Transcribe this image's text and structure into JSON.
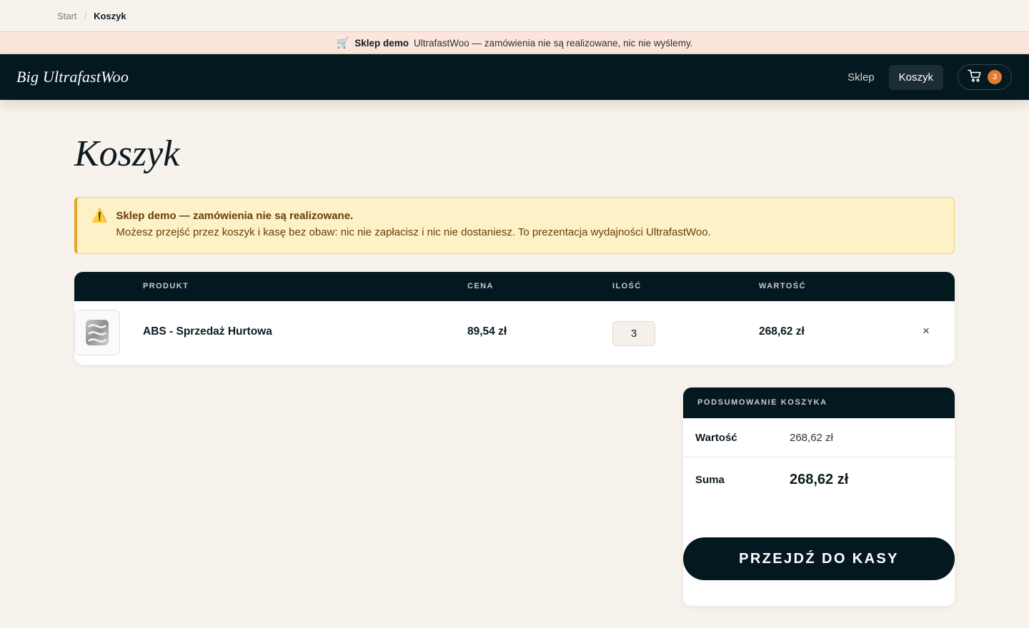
{
  "breadcrumb": {
    "start": "Start",
    "separator": "/",
    "current": "Koszyk"
  },
  "demo_strip": {
    "icon": "shopping-cart-emoji",
    "strong": "Sklep demo",
    "text": "UltrafastWoo — zamówienia nie są realizowane, nic nie wyślemy."
  },
  "header": {
    "logo": "Big UltrafastWoo",
    "nav": {
      "shop": "Sklep",
      "cart": "Koszyk"
    },
    "cart_count": "3"
  },
  "page": {
    "title": "Koszyk"
  },
  "notice": {
    "icon": "warning-icon",
    "title": "Sklep demo — zamówienia nie są realizowane.",
    "text": "Możesz przejść przez koszyk i kasę bez obaw: nic nie zapłacisz i nic nie dostaniesz. To prezentacja wydajności UltrafastWoo."
  },
  "table": {
    "headers": {
      "product": "PRODUKT",
      "price": "CENA",
      "qty": "ILOŚĆ",
      "total": "WARTOŚĆ"
    },
    "rows": [
      {
        "name": "ABS - Sprzedaż Hurtowa",
        "price": "89,54 zł",
        "qty": "3",
        "total": "268,62 zł",
        "remove": "×"
      }
    ]
  },
  "summary": {
    "title": "PODSUMOWANIE KOSZYKA",
    "subtotal_label": "Wartość",
    "subtotal_value": "268,62 zł",
    "total_label": "Suma",
    "total_value": "268,62 zł",
    "checkout_label": "PRZEJDŹ DO KASY"
  },
  "colors": {
    "dark": "#041820",
    "background": "#f7f3ec",
    "badge": "#e07a2e",
    "notice_bg": "#fdf1c7",
    "notice_border": "#e3a629",
    "demo_strip_bg": "#fbe6de"
  }
}
